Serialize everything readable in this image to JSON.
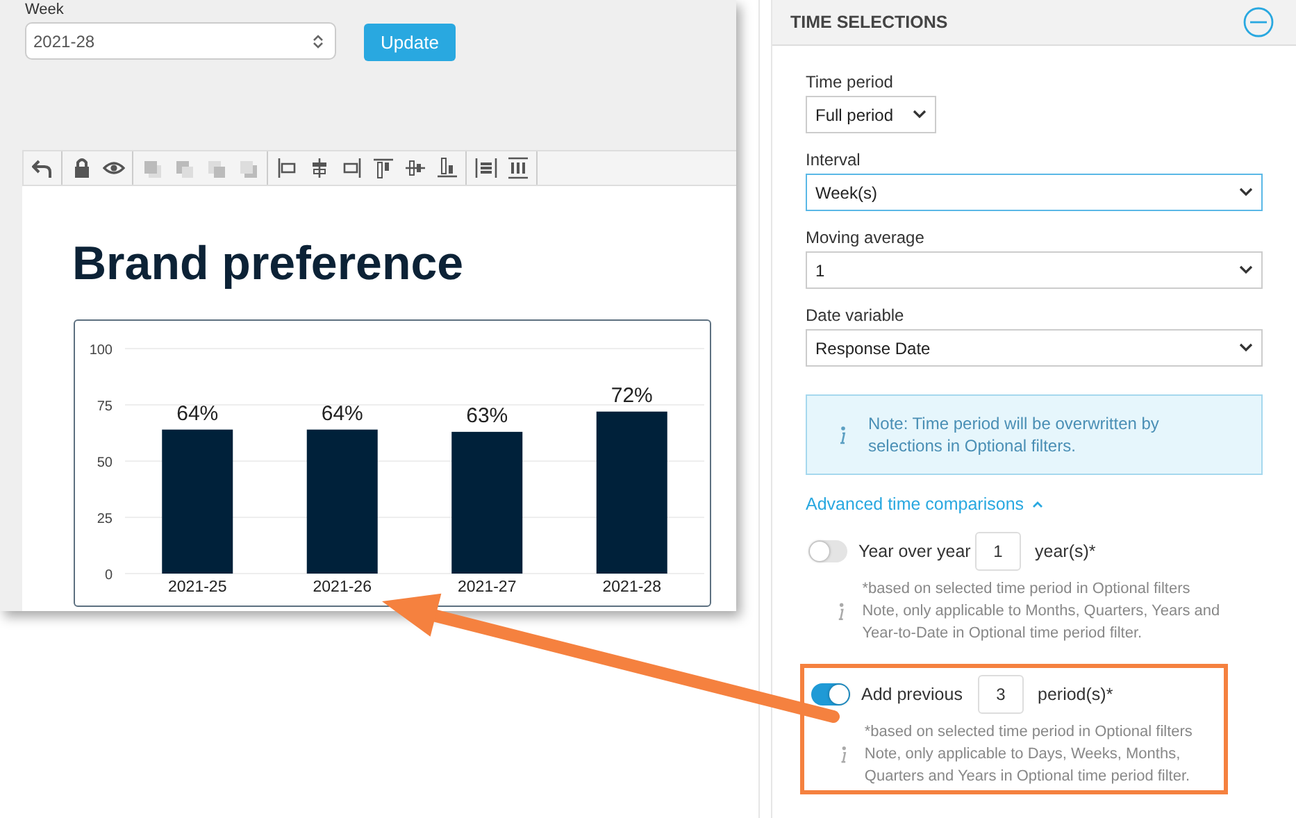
{
  "week_filter": {
    "label": "Week",
    "value": "2021-28"
  },
  "update_button": "Update",
  "report": {
    "title": "Brand preference",
    "chart_data": {
      "type": "bar",
      "categories": [
        "2021-25",
        "2021-26",
        "2021-27",
        "2021-28"
      ],
      "series": [
        {
          "color": "#00213a",
          "values": [
            64,
            64,
            63,
            72
          ]
        }
      ],
      "grid": true,
      "ylim": [
        0,
        100
      ],
      "yticks": [
        0,
        25,
        50,
        75,
        100
      ],
      "value_labels": [
        "64%",
        "64%",
        "63%",
        "72%"
      ]
    }
  },
  "time_selections": {
    "title": "TIME SELECTIONS",
    "expanded": true,
    "fields": [
      {
        "label": "Time period",
        "value": "Full period",
        "focused": false
      },
      {
        "label": "Interval",
        "value": "Week(s)",
        "focused": true
      },
      {
        "label": "Moving average",
        "value": "1",
        "focused": false
      },
      {
        "label": "Date variable",
        "value": "Response Date",
        "focused": false
      }
    ],
    "note": "Note: Time period will be overwritten by selections in Optional filters.",
    "advanced": {
      "label": "Advanced time comparisons",
      "expanded": true
    },
    "comparisons": [
      {
        "label": "Year over year",
        "on": false,
        "value": "1",
        "unit": "year(s)*",
        "notes": [
          "*based on selected time period in Optional filters",
          "Note, only applicable to Months, Quarters, Years and Year-to-Date in Optional time period filter."
        ]
      },
      {
        "label": "Add previous",
        "on": true,
        "value": "3",
        "unit": "period(s)*",
        "highlighted": true,
        "notes": [
          "*based on selected time period in Optional filters",
          "Note, only applicable to Days, Weeks, Months, Quarters and Years in Optional time period filter."
        ]
      }
    ]
  }
}
